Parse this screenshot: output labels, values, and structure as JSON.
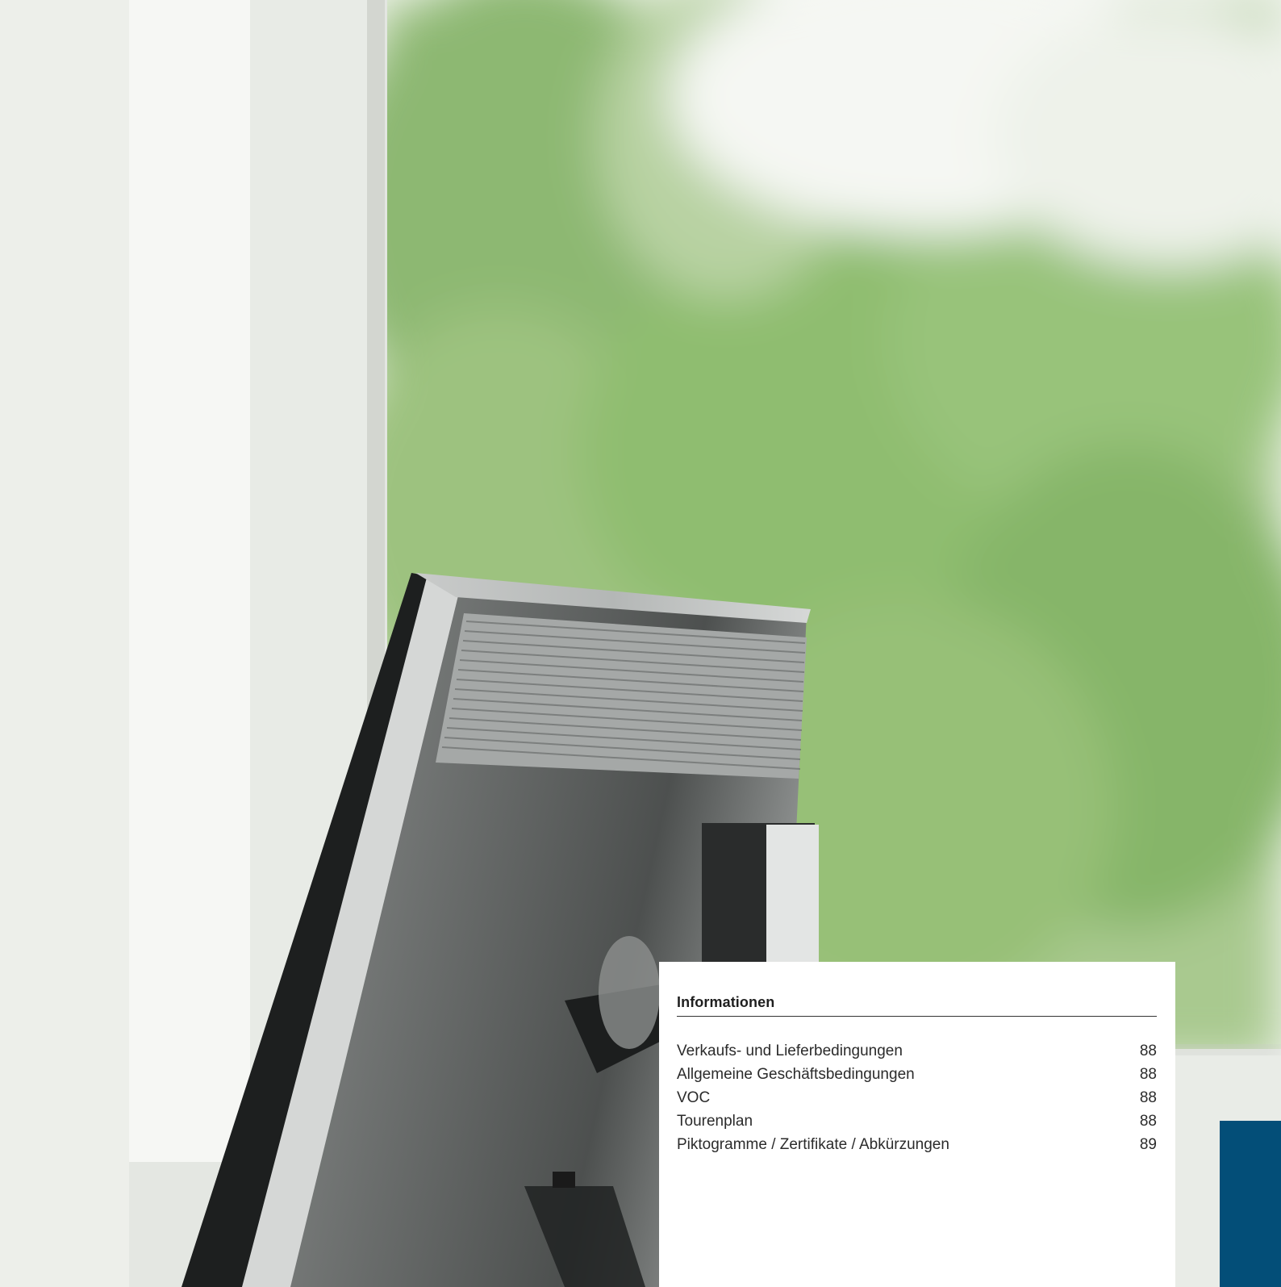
{
  "index": {
    "heading": "Informationen",
    "items": [
      {
        "label": "Verkaufs- und Lieferbedingungen",
        "page": "88"
      },
      {
        "label": "Allgemeine Geschäftsbedingungen",
        "page": "88"
      },
      {
        "label": "VOC",
        "page": "88"
      },
      {
        "label": "Tourenplan",
        "page": "88"
      },
      {
        "label": "Piktogramme / Zertifikate / Abkürzungen",
        "page": "89"
      }
    ]
  },
  "colors": {
    "accent_blue": "#034e78",
    "panel_bg": "#ffffff",
    "text": "#2b2b2b"
  },
  "photo": {
    "subject": "monitor-back-by-window-icon"
  }
}
